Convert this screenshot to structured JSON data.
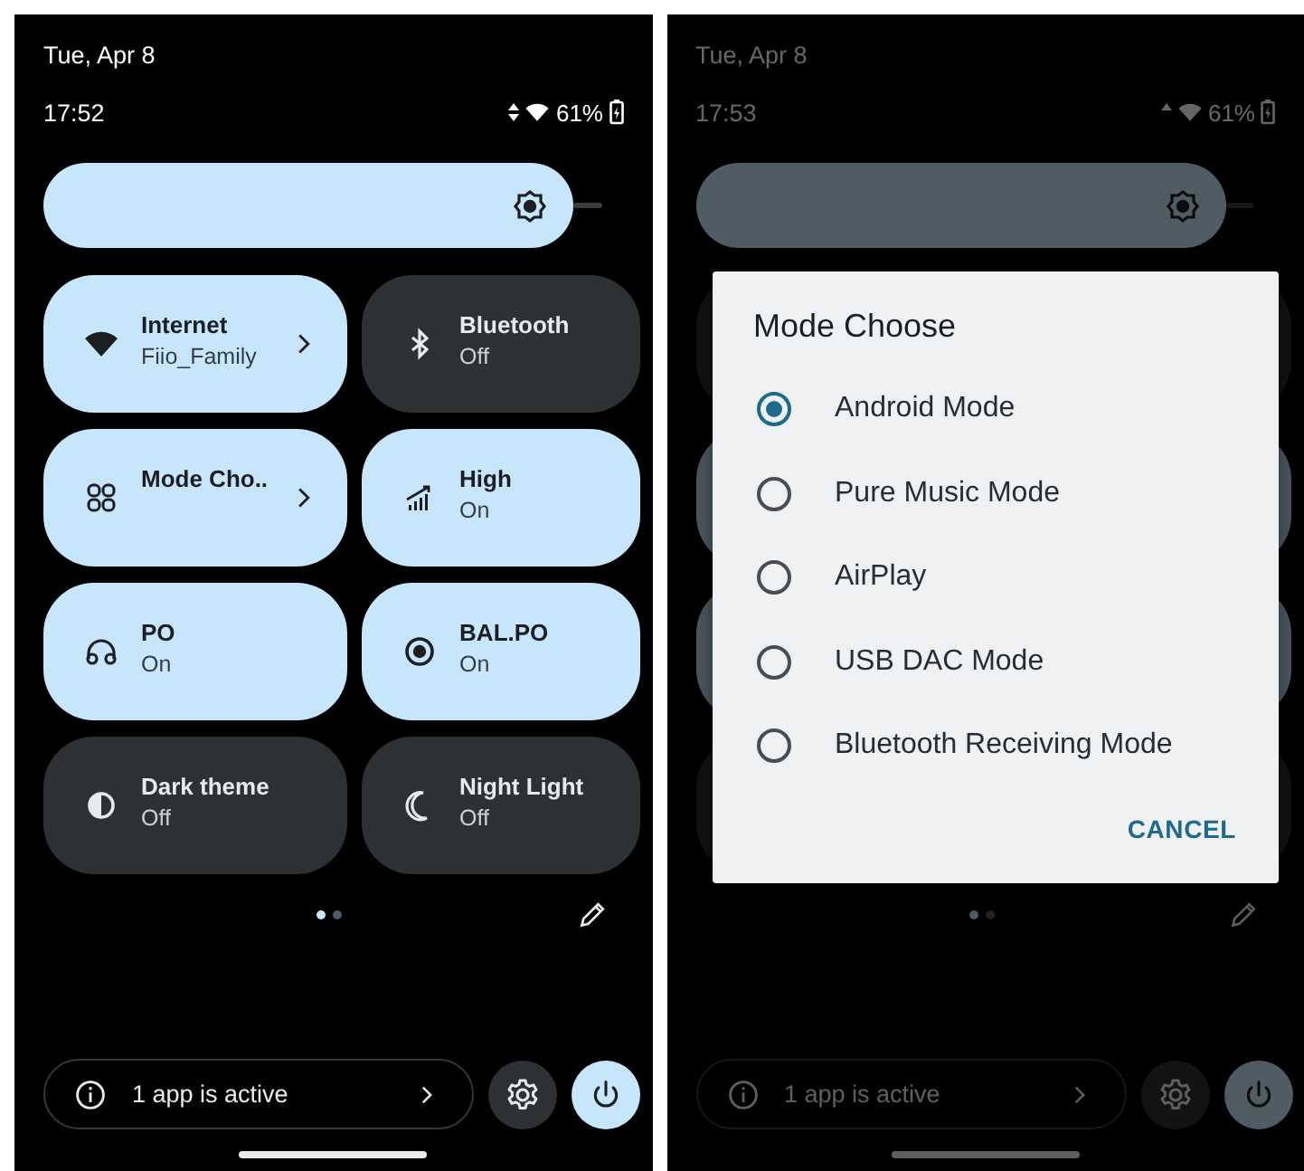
{
  "screens": [
    {
      "date": "Tue, Apr 8",
      "time": "17:52",
      "data_activity": {
        "up": true,
        "down": true
      },
      "battery": "61%",
      "brightness": {
        "level": 0.95
      },
      "tiles": [
        {
          "kind": "wifi",
          "label": "Internet",
          "status": "Fiio_Family",
          "on": true,
          "chevron": true
        },
        {
          "kind": "bluetooth",
          "label": "Bluetooth",
          "status": "Off",
          "on": false,
          "chevron": false
        },
        {
          "kind": "grid",
          "label": "Mode Cho..",
          "on": true,
          "chevron": true
        },
        {
          "kind": "signal",
          "label": "High",
          "status": "On",
          "on": true,
          "chevron": false
        },
        {
          "kind": "headphones",
          "label": "PO",
          "status": "On",
          "on": true,
          "chevron": false
        },
        {
          "kind": "radio",
          "label": "BAL.PO",
          "status": "On",
          "on": true,
          "chevron": false
        },
        {
          "kind": "contrast",
          "label": "Dark theme",
          "status": "Off",
          "on": false,
          "chevron": false
        },
        {
          "kind": "moon",
          "label": "Night Light",
          "status": "Off",
          "on": false,
          "chevron": false
        }
      ],
      "pages": [
        {
          "selected": true
        },
        {
          "selected": false
        }
      ],
      "footer": {
        "text": "1 app is active"
      }
    },
    {
      "date": "Tue, Apr 8",
      "time": "17:53",
      "data_activity": {
        "up": true,
        "down": false
      },
      "battery": "61%",
      "brightness": {
        "level": 0.95
      },
      "tiles": [
        {
          "on": false
        },
        {
          "on": false
        },
        {
          "on": true
        },
        {
          "on": true
        },
        {
          "on": true
        },
        {
          "on": true
        },
        {
          "on": false
        },
        {
          "on": false
        }
      ],
      "pages": [
        {
          "selected": true
        },
        {
          "selected": false
        }
      ],
      "footer": {
        "text": "1 app is active"
      },
      "dialog": {
        "title": "Mode Choose",
        "options": [
          {
            "label": "Android Mode",
            "selected": true
          },
          {
            "label": "Pure Music Mode",
            "selected": false
          },
          {
            "label": "AirPlay",
            "selected": false
          },
          {
            "label": "USB DAC Mode",
            "selected": false
          },
          {
            "label": "Bluetooth Receiving Mode",
            "selected": false
          }
        ],
        "button": "CANCEL"
      }
    }
  ]
}
